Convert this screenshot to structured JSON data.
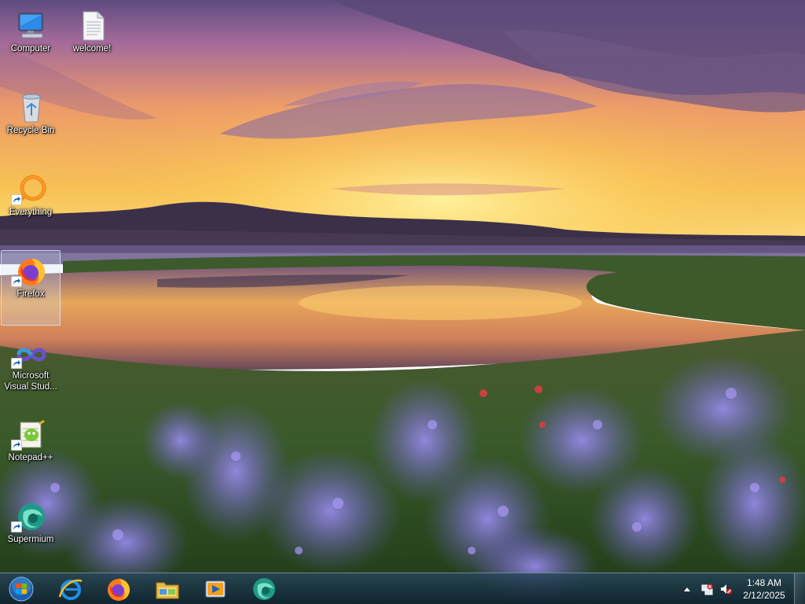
{
  "desktop": {
    "icons": [
      {
        "label": "Computer",
        "icon": "computer-icon"
      },
      {
        "label": "welcome!",
        "icon": "text-file-icon"
      },
      {
        "label": "Recycle Bin",
        "icon": "recycle-bin-icon"
      },
      {
        "label": "Everything",
        "icon": "everything-icon"
      },
      {
        "label": "Firefox",
        "icon": "firefox-icon"
      },
      {
        "label": "Microsoft Visual Stud...",
        "icon": "visual-studio-icon"
      },
      {
        "label": "Notepad++",
        "icon": "notepad-plus-plus-icon"
      },
      {
        "label": "Supermium",
        "icon": "supermium-icon"
      }
    ],
    "selected_icon": "Firefox"
  },
  "taskbar": {
    "pinned": [
      {
        "icon": "start-orb-icon"
      },
      {
        "icon": "internet-explorer-icon"
      },
      {
        "icon": "firefox-icon"
      },
      {
        "icon": "file-explorer-icon"
      },
      {
        "icon": "media-player-icon"
      },
      {
        "icon": "supermium-icon"
      }
    ],
    "tray": {
      "icons": [
        "show-hidden-icons-icon",
        "network-icon",
        "volume-muted-icon"
      ],
      "time": "1:48 AM",
      "date": "2/12/2025"
    }
  },
  "colors": {
    "taskbar": "#1e3a4c",
    "sky_top": "#5b4a80",
    "sky_glow": "#f5c64a",
    "flowers": "#7a6ad8"
  }
}
